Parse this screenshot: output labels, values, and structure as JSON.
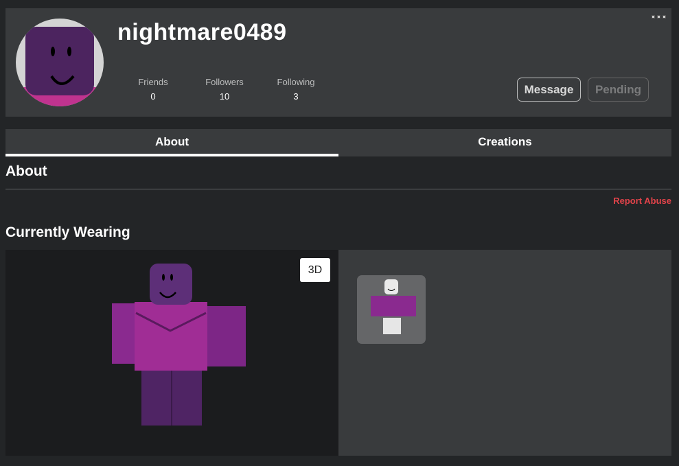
{
  "profile": {
    "username": "nightmare0489",
    "stats": [
      {
        "label": "Friends",
        "value": "0"
      },
      {
        "label": "Followers",
        "value": "10"
      },
      {
        "label": "Following",
        "value": "3"
      }
    ],
    "buttons": {
      "message": "Message",
      "pending": "Pending"
    },
    "more_icon": "more-options-icon"
  },
  "tabs": [
    {
      "label": "About",
      "active": true
    },
    {
      "label": "Creations",
      "active": false
    }
  ],
  "about": {
    "heading": "About",
    "report_abuse": "Report Abuse"
  },
  "wearing": {
    "heading": "Currently Wearing",
    "toggle_3d": "3D"
  },
  "colors": {
    "accent_purple": "#5b2a6e",
    "shirt_pink": "#c0338f",
    "report_red": "#e2434a"
  }
}
